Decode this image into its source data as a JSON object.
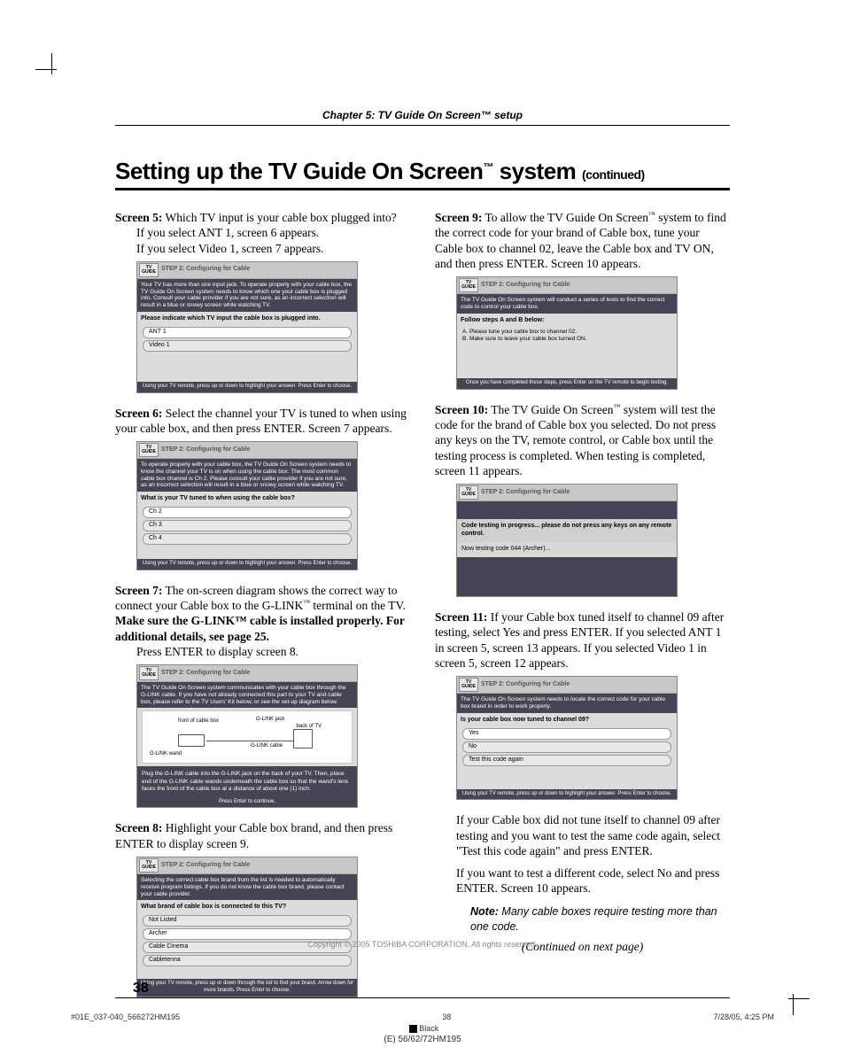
{
  "chapter": "Chapter 5: TV Guide On Screen™ setup",
  "headline_main": "Setting up the TV Guide On Screen",
  "headline_tm": "™",
  "headline_tail": " system ",
  "headline_cont": "(continued)",
  "left": {
    "s5_label": "Screen 5:",
    "s5_text": " Which TV input is your cable box plugged into?",
    "s5_l2": "If you select ANT 1, screen 6 appears.",
    "s5_l3": "If you select Video 1, screen 7 appears.",
    "shot5": {
      "title": "STEP 2: Configuring for Cable",
      "top": "Your TV has more than one input jack. To operate properly with your cable box, the TV Guide On Screen system needs to know which one your cable box is plugged into. Consult your cable provider if you are not sure, as an incorrect selection will result in a blue or snowy screen while watching TV.",
      "q": "Please indicate which TV input the cable box is plugged into.",
      "opts": [
        "ANT 1",
        "Video 1"
      ],
      "foot": "Using your TV remote, press up or down to highlight your answer. Press Enter to choose."
    },
    "s6_label": "Screen 6:",
    "s6_text": " Select the channel your TV is tuned to when using your cable box, and then press ENTER. Screen 7 appears.",
    "shot6": {
      "title": "STEP 2: Configuring for Cable",
      "top": "To operate properly with your cable box, the TV Guide On Screen system needs to know the channel your TV is on when using the cable box. The most common cable box channel is Ch 2. Please consult your cable provider if you are not sure, as an incorrect selection will result in a blue or snowy screen while watching TV.",
      "q": "What is your TV tuned to when using the cable box?",
      "opts": [
        "Ch 2",
        "Ch 3",
        "Ch 4"
      ],
      "foot": "Using your TV remote, press up or down to highlight your answer. Press Enter to choose."
    },
    "s7_label": "Screen 7:",
    "s7_text_a": " The on-screen diagram shows the correct way to connect your Cable box to the G-LINK",
    "s7_text_b": " terminal on the TV. ",
    "s7_bold": "Make sure the G-LINK™ cable is installed properly. For additional details, see page 25.",
    "s7_l2": "Press ENTER to display screen 8.",
    "shot7": {
      "title": "STEP 2: Configuring for Cable",
      "top": "The TV Guide On Screen system communicates with your cable box through the G-LINK cable. If you have not already connected this part to your TV and cable box, please refer to the TV Users' Kit below, or see the set-up diagram below.",
      "diag_front": "front of cable box",
      "diag_back": "back of TV",
      "diag_glink": "G-LINK jack",
      "diag_cable": "G-LINK cable",
      "diag_wand": "G-LINK wand",
      "mid": "Plug the G-LINK cable into the G-LINK jack on the back of your TV. Then, place end of the G-LINK cable wands underneath the cable box so that the wand's lens faces the front of the cable box at a distance of about one (1) inch.",
      "foot": "Press Enter to continue."
    },
    "s8_label": "Screen 8:",
    "s8_text": " Highlight your Cable box brand, and then press ENTER to display screen 9.",
    "shot8": {
      "title": "STEP 2: Configuring for Cable",
      "top": "Selecting the correct cable box brand from the list is needed to automatically receive program listings. If you do not know the cable box brand, please contact your cable provider.",
      "q": "What brand of cable box is connected to this TV?",
      "opts": [
        "Not Listed",
        "Archer",
        "Cable Cinema",
        "Cabletenna"
      ],
      "foot": "Using your TV remote, press up or down through the list to find your brand. Arrow down for more brands. Press Enter to choose."
    }
  },
  "right": {
    "s9_label": "Screen 9:",
    "s9_text_a": " To allow the TV Guide On Screen",
    "s9_text_b": " system to find the correct code for your brand of Cable box, tune your Cable box to channel 02, leave the Cable box and TV ON, and then press ENTER. Screen 10 appears.",
    "shot9": {
      "title": "STEP 2: Configuring for Cable",
      "top": "The TV Guide On Screen system will conduct a series of tests to find the correct code to control your cable box.",
      "q": "Follow steps A and B below:",
      "a": "A.  Please tune your cable box to channel 02.",
      "b": "B.  Make sure to leave your cable box turned ON.",
      "foot": "Once you have completed these steps, press Enter on the TV remote to begin testing."
    },
    "s10_label": "Screen 10:",
    "s10_text_a": " The TV Guide On Screen",
    "s10_text_b": " system will test the code for the brand of Cable box you selected. Do not press any keys on the TV, remote control, or Cable box until the testing process is completed. When testing is completed, screen 11 appears.",
    "shot10": {
      "title": "STEP 2: Configuring for Cable",
      "l1": "Code testing in progress... please do not press any keys on any remote control.",
      "l2": "Now testing code 044 (Archer)..."
    },
    "s11_label": "Screen 11:",
    "s11_text": " If your Cable box tuned itself to channel 09 after testing, select Yes and press ENTER. If you selected ANT 1 in screen 5, screen 13 appears. If you selected Video 1 in screen 5, screen 12 appears.",
    "shot11": {
      "title": "STEP 2: Configuring for Cable",
      "top": "The TV Guide On Screen system needs to locate the correct code for your cable box brand in order to work properly.",
      "q": "Is your cable box now tuned to channel 09?",
      "opts": [
        "Yes",
        "No",
        "Test this code again"
      ],
      "foot": "Using your TV remote, press up or down to highlight your answer. Press Enter to choose."
    },
    "p_after_a": "If your Cable box did not tune itself to channel 09 after testing and you want to test the same code again, select \"Test this code again\" and press ENTER.",
    "p_after_b": "If you want to test a different code, select No and press ENTER. Screen 10 appears.",
    "note_label": "Note:",
    "note_body": " Many cable boxes require testing more than one code.",
    "continued": "(Continued on next page)"
  },
  "pagenum": "38",
  "copyright": "Copyright © 2005 TOSHIBA CORPORATION. All rights reserved.",
  "imposition": {
    "job": "#01E_037-040_566272HM195",
    "pg": "38",
    "date": "7/28/05, 4:25 PM",
    "color": "Black",
    "model": "(E) 56/62/72HM195"
  },
  "tvbadge_top": "TV",
  "tvbadge_bot": "GUIDE"
}
